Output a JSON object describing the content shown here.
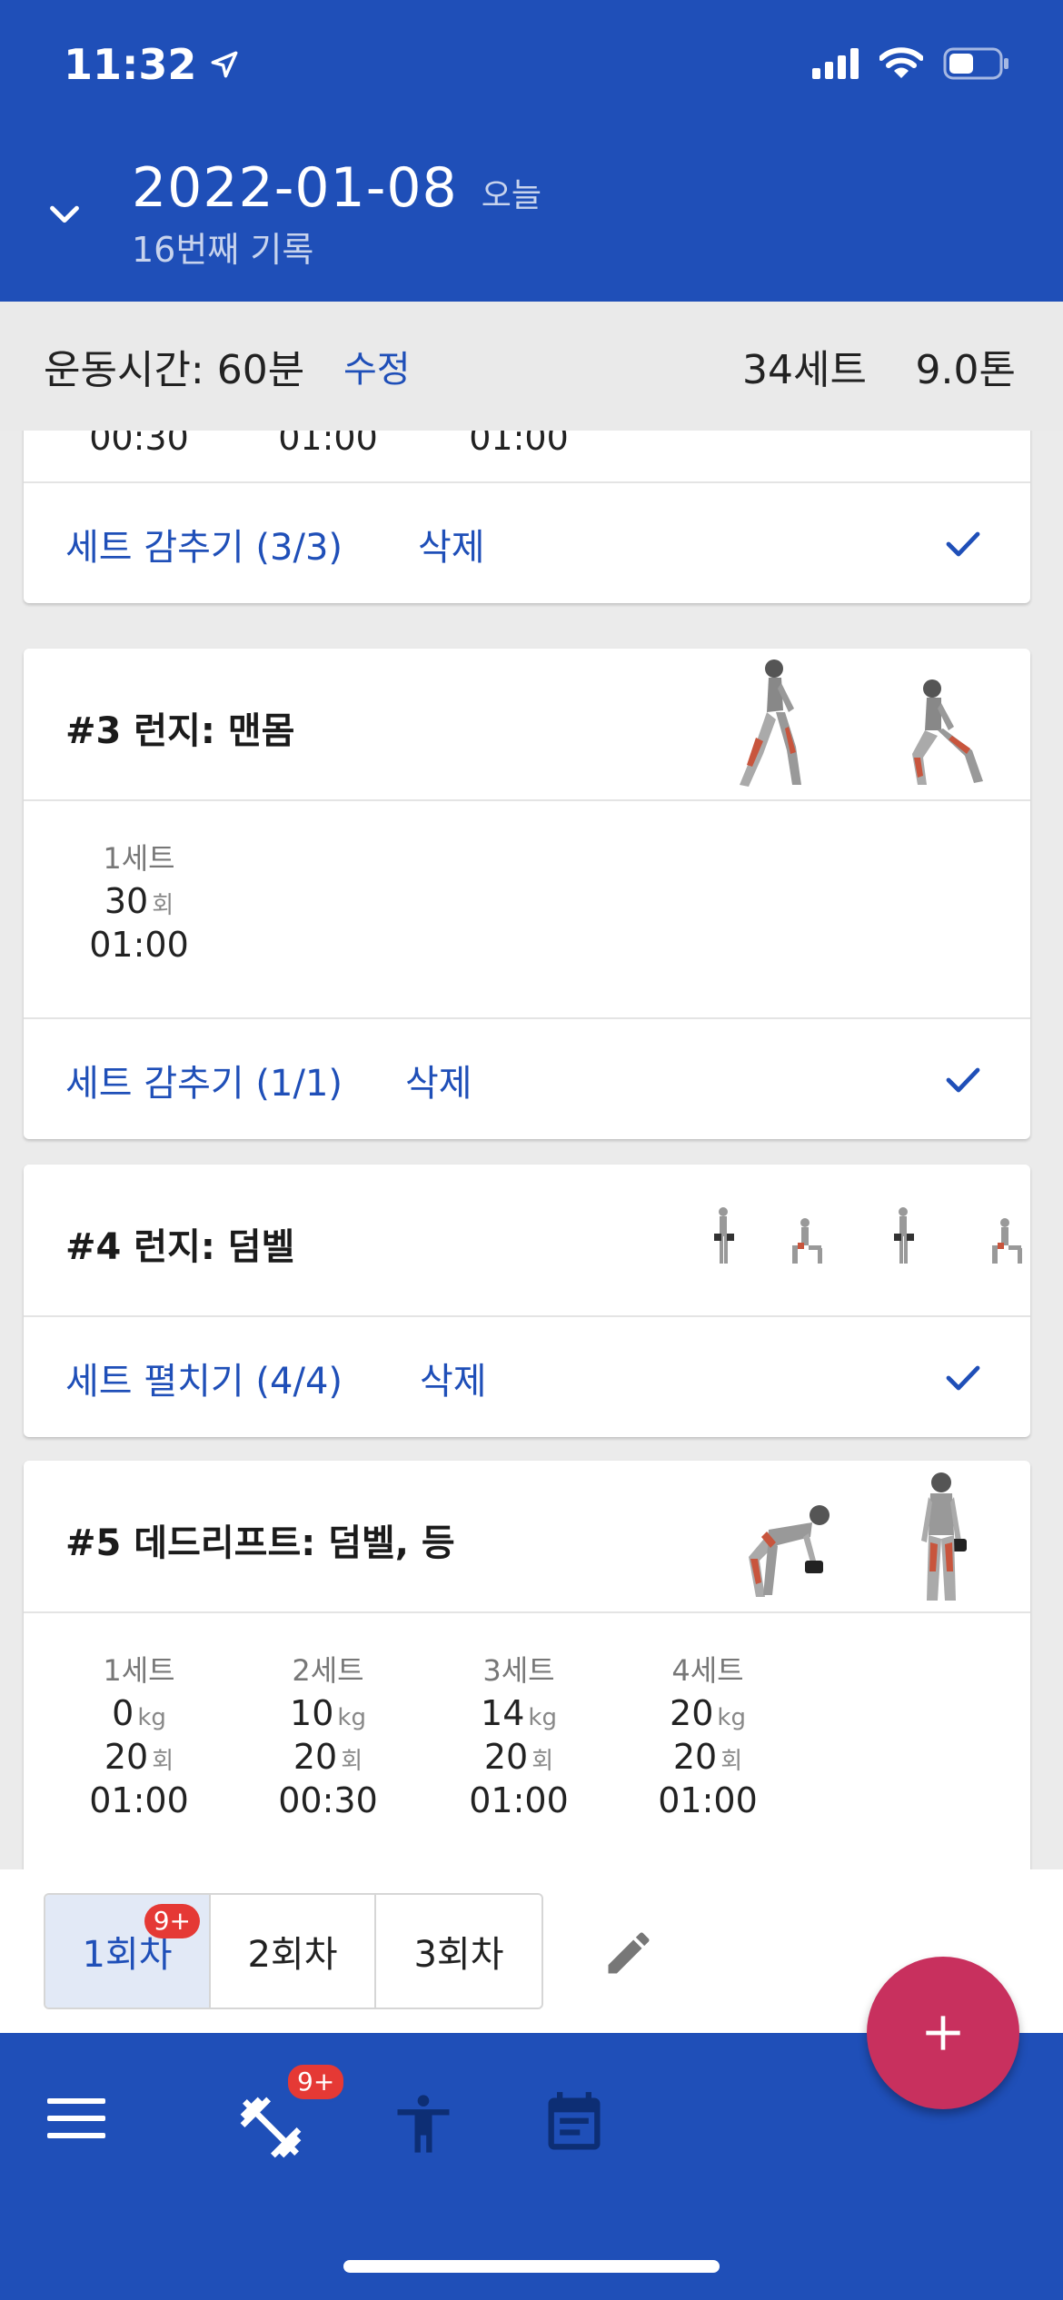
{
  "status": {
    "time": "11:32"
  },
  "header": {
    "date": "2022-01-08",
    "today": "오늘",
    "subtitle": "16번째 기록"
  },
  "summary": {
    "duration": "운동시간: 60분",
    "edit": "수정",
    "sets": "34세트",
    "tons": "9.0톤"
  },
  "card_prev": {
    "times": [
      "00:30",
      "01:00",
      "01:00"
    ],
    "toggle": "세트 감추기 (3/3)",
    "delete": "삭제"
  },
  "card3": {
    "title": "#3 런지: 맨몸",
    "sets": [
      {
        "label": "1세트",
        "reps": "30",
        "reps_unit": "회",
        "time": "01:00"
      }
    ],
    "toggle": "세트 감추기 (1/1)",
    "delete": "삭제"
  },
  "card4": {
    "title": "#4 런지: 덤벨",
    "toggle": "세트 펼치기 (4/4)",
    "delete": "삭제"
  },
  "card5": {
    "title": "#5 데드리프트: 덤벨, 등",
    "sets": [
      {
        "label": "1세트",
        "weight": "0",
        "weight_unit": "kg",
        "reps": "20",
        "reps_unit": "회",
        "time": "01:00"
      },
      {
        "label": "2세트",
        "weight": "10",
        "weight_unit": "kg",
        "reps": "20",
        "reps_unit": "회",
        "time": "00:30"
      },
      {
        "label": "3세트",
        "weight": "14",
        "weight_unit": "kg",
        "reps": "20",
        "reps_unit": "회",
        "time": "01:00"
      },
      {
        "label": "4세트",
        "weight": "20",
        "weight_unit": "kg",
        "reps": "20",
        "reps_unit": "회",
        "time": "01:00"
      }
    ]
  },
  "sessions": {
    "tabs": [
      {
        "label": "1회차",
        "badge": "9+"
      },
      {
        "label": "2회차"
      },
      {
        "label": "3회차"
      }
    ]
  },
  "nav": {
    "workout_badge": "9+"
  },
  "colors": {
    "primary": "#1f4fb8",
    "accent": "#c8305e",
    "badge": "#e53935",
    "muscle": "#c8553d"
  },
  "icons": [
    "location-arrow-icon",
    "signal-icon",
    "wifi-icon",
    "battery-icon",
    "chevron-down-icon",
    "check-icon",
    "pencil-icon",
    "menu-icon",
    "dumbbell-icon",
    "person-icon",
    "calendar-icon",
    "plus-icon"
  ]
}
